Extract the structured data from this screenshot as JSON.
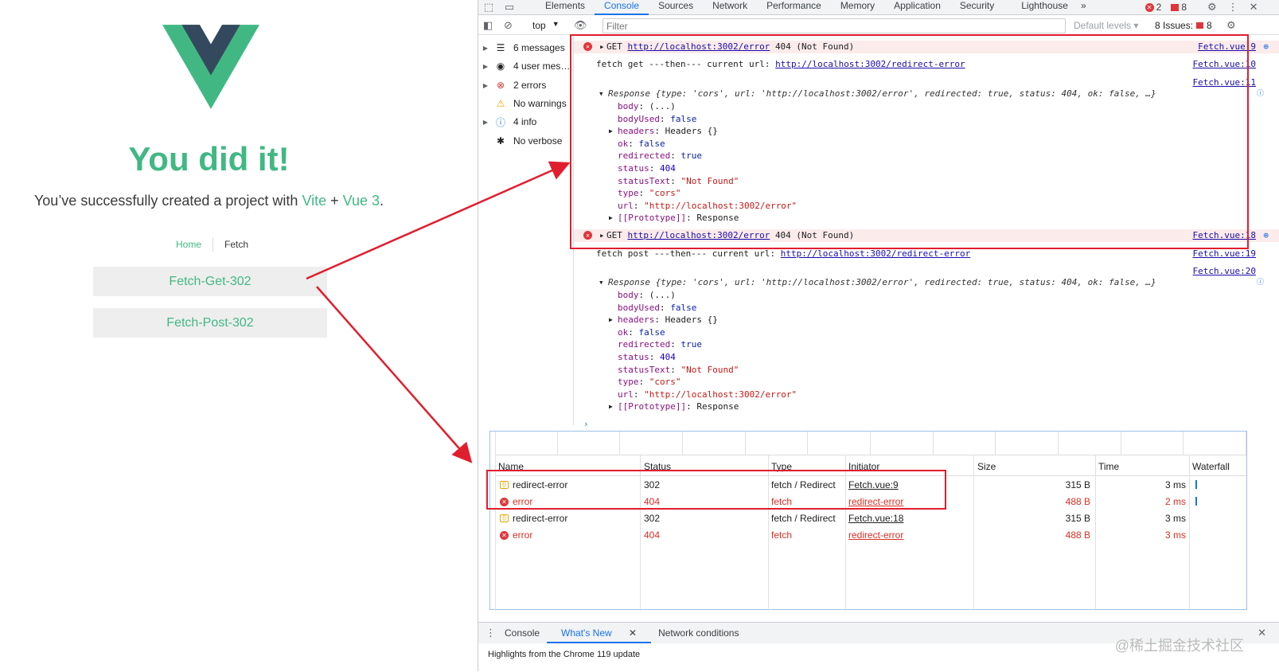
{
  "app": {
    "title": "You did it!",
    "subtitle_pre": "You’ve successfully created a project with ",
    "vite": "Vite",
    "plus": " + ",
    "vue": "Vue 3",
    "period": ".",
    "nav": {
      "home": "Home",
      "fetch": "Fetch"
    },
    "buttons": {
      "get": "Fetch-Get-302",
      "post": "Fetch-Post-302"
    }
  },
  "devtools": {
    "tabs": [
      "Elements",
      "Console",
      "Sources",
      "Network",
      "Performance",
      "Memory",
      "Application",
      "Security",
      "Lighthouse"
    ],
    "active_tab": "Console",
    "more_tabs": "»",
    "error_count": "2",
    "warn_count": "8",
    "context": "top",
    "filter_placeholder": "Filter",
    "levels": "Default levels",
    "issues_label": "8 Issues:",
    "issues_count": "8",
    "sidebar": [
      {
        "label": "6 messages",
        "icon": "list-icon"
      },
      {
        "label": "4 user mes…",
        "icon": "user-icon"
      },
      {
        "label": "2 errors",
        "icon": "error-icon"
      },
      {
        "label": "No warnings",
        "icon": "warning-icon"
      },
      {
        "label": "4 info",
        "icon": "info-icon"
      },
      {
        "label": "No verbose",
        "icon": "bug-icon"
      }
    ],
    "console": {
      "err1": {
        "method": "GET",
        "url": "http://localhost:3002/error",
        "status": "404 (Not Found)",
        "src": "Fetch.vue:9"
      },
      "log_get": {
        "text": "fetch get ---then--- current url:",
        "url": "http://localhost:3002/redirect-error",
        "src": "Fetch.vue:10"
      },
      "src_11": "Fetch.vue:11",
      "response_summary_pre": "Response",
      "response_summary": "{type: 'cors', url: 'http://localhost:3002/error', redirected: true, status: 404, ok: false, …}",
      "props": [
        {
          "k": "body",
          "v": "(...)"
        },
        {
          "k": "bodyUsed",
          "v": "false"
        },
        {
          "k": "headers",
          "v": "Headers {}"
        },
        {
          "k": "ok",
          "v": "false"
        },
        {
          "k": "redirected",
          "v": "true"
        },
        {
          "k": "status",
          "v": "404"
        },
        {
          "k": "statusText",
          "v": "\"Not Found\""
        },
        {
          "k": "type",
          "v": "\"cors\""
        },
        {
          "k": "url",
          "v": "\"http://localhost:3002/error\""
        },
        {
          "k": "[[Prototype]]",
          "v": "Response"
        }
      ],
      "err2": {
        "method": "GET",
        "url": "http://localhost:3002/error",
        "status": "404 (Not Found)",
        "src": "Fetch.vue:18"
      },
      "log_post": {
        "text": "fetch post ---then--- current url:",
        "url": "http://localhost:3002/redirect-error",
        "src": "Fetch.vue:19"
      },
      "src_20": "Fetch.vue:20",
      "prompt": "›"
    },
    "network": {
      "headers": [
        "Name",
        "Status",
        "Type",
        "Initiator",
        "Size",
        "Time",
        "Waterfall"
      ],
      "rows": [
        {
          "name": "redirect-error",
          "status": "302",
          "type": "fetch / Redirect",
          "initiator": "Fetch.vue:9",
          "size": "315 B",
          "time": "3 ms",
          "error": false
        },
        {
          "name": "error",
          "status": "404",
          "type": "fetch",
          "initiator": "redirect-error",
          "size": "488 B",
          "time": "2 ms",
          "error": true
        },
        {
          "name": "redirect-error",
          "status": "302",
          "type": "fetch / Redirect",
          "initiator": "Fetch.vue:18",
          "size": "315 B",
          "time": "3 ms",
          "error": false
        },
        {
          "name": "error",
          "status": "404",
          "type": "fetch",
          "initiator": "redirect-error",
          "size": "488 B",
          "time": "3 ms",
          "error": true
        }
      ]
    },
    "drawer": {
      "tabs": [
        "Console",
        "What's New",
        "Network conditions"
      ],
      "body": "Highlights from the Chrome 119 update"
    }
  },
  "watermark": "@稀土掘金技术社区",
  "colors": {
    "vue_green": "#41b883",
    "vue_dark": "#34495e",
    "annotation_red": "#e01e2e",
    "devtools_blue": "#1a73e8",
    "error_red": "#d93025"
  }
}
